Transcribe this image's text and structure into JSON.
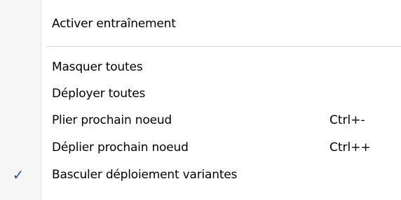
{
  "menu": {
    "items": [
      {
        "label": "Activer entraînement",
        "shortcut": "",
        "checked": false
      },
      {
        "label": "Masquer toutes",
        "shortcut": "",
        "checked": false
      },
      {
        "label": "Déployer toutes",
        "shortcut": "",
        "checked": false
      },
      {
        "label": "Plier prochain noeud",
        "shortcut": "Ctrl+-",
        "checked": false
      },
      {
        "label": "Déplier prochain noeud",
        "shortcut": "Ctrl++",
        "checked": false
      },
      {
        "label": "Basculer déploiement variantes",
        "shortcut": "",
        "checked": true
      }
    ],
    "check_glyph": "✓",
    "colors": {
      "gutter": "#f6f6f6",
      "check": "#2b4f9e",
      "separator": "#d6d6d6"
    }
  }
}
